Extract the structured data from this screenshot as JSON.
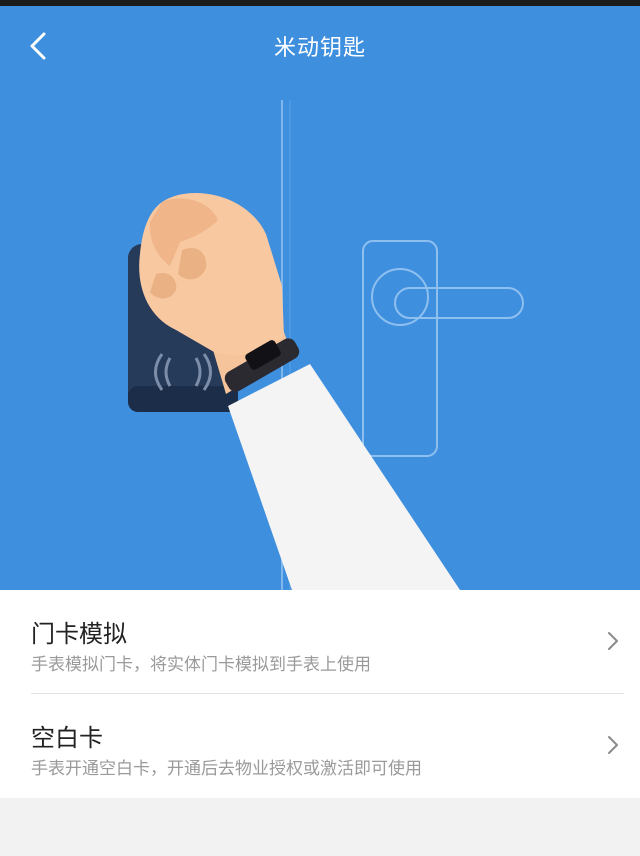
{
  "header": {
    "title": "米动钥匙",
    "back_icon": "chevron-left-icon"
  },
  "illustration": {
    "description_icon": "wristband-unlock-illustration"
  },
  "options": [
    {
      "title": "门卡模拟",
      "subtitle": "手表模拟门卡，将实体门卡模拟到手表上使用",
      "icon": "chevron-right-icon"
    },
    {
      "title": "空白卡",
      "subtitle": "手表开通空白卡，开通后去物业授权或激活即可使用",
      "icon": "chevron-right-icon"
    }
  ],
  "colors": {
    "hero_bg": "#3f8fdf",
    "page_bg": "#f2f2f2",
    "title_text": "#222222",
    "subtitle_text": "#9a9a9a"
  }
}
